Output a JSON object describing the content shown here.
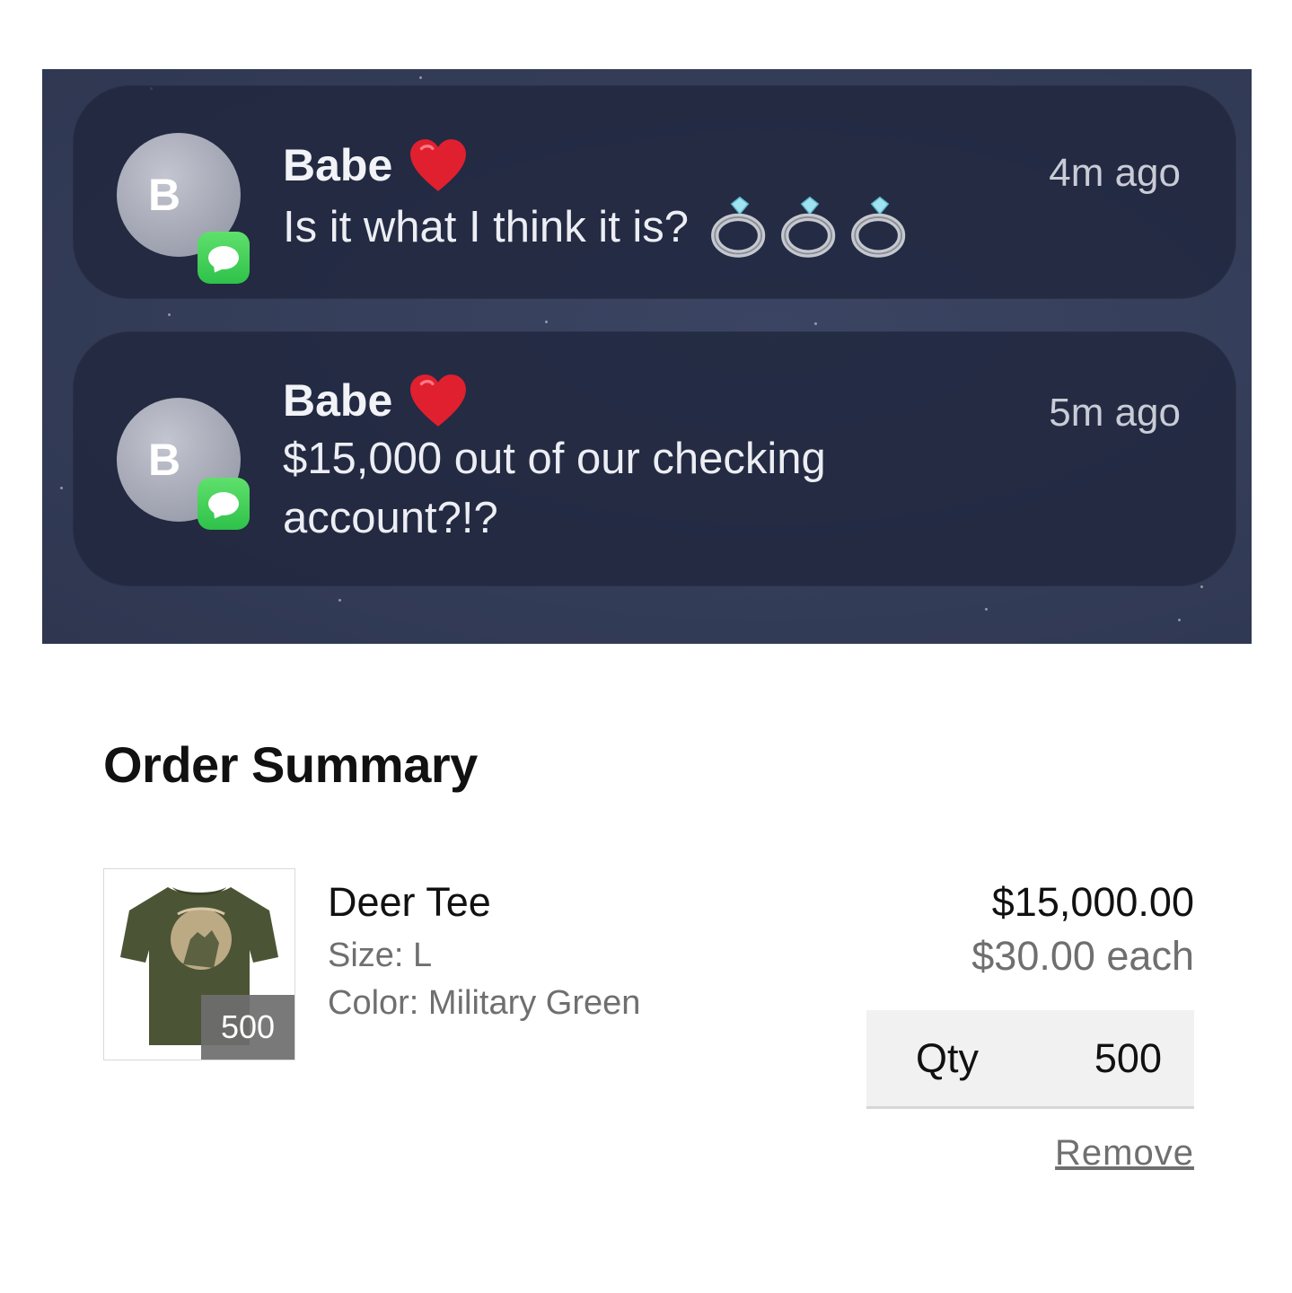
{
  "notifications": [
    {
      "avatar_initial": "B",
      "sender": "Babe",
      "sender_emoji": "red-heart-icon",
      "timestamp": "4m ago",
      "message": "Is it what I think it is?",
      "message_emoji": [
        "ring-icon",
        "ring-icon",
        "ring-icon"
      ],
      "app_badge": "messages-icon"
    },
    {
      "avatar_initial": "B",
      "sender": "Babe",
      "sender_emoji": "red-heart-icon",
      "timestamp": "5m ago",
      "message": "$15,000 out of our checking account?!?",
      "app_badge": "messages-icon"
    }
  ],
  "order_summary": {
    "title": "Order Summary",
    "item": {
      "name": "Deer Tee",
      "size_label": "Size: L",
      "color_label": "Color: Military Green",
      "thumbnail_qty": "500",
      "line_total": "$15,000.00",
      "unit_price": "$30.00 each",
      "qty_label": "Qty",
      "qty_value": "500",
      "remove_label": "Remove"
    }
  },
  "colors": {
    "panel_bg": "#343d58",
    "card_bg": "#1f253c",
    "badge_green": "#34c759",
    "heart_red": "#e0202f",
    "tee_green": "#4b5535"
  }
}
